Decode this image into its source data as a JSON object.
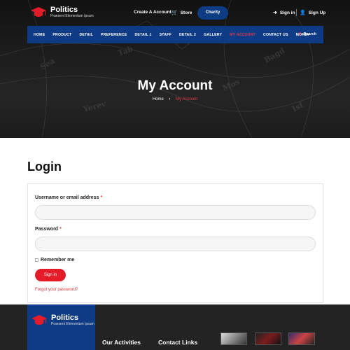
{
  "brand": {
    "name": "Politics",
    "tagline": "Praesent Elementum Ipsum"
  },
  "topbar": {
    "create_account": "Create A Account",
    "store": "Store",
    "charity": "Charity",
    "sign_in": "Sign in",
    "sign_up": "Sign Up"
  },
  "nav": {
    "items": [
      "HOME",
      "PRODUCT",
      "DETAIL",
      "PREFERENCE",
      "DETAIL 1",
      "STAFF",
      "DETAIL 2",
      "GALLERY",
      "MY ACCOUNT",
      "CONTACT US",
      "MORE"
    ],
    "search": "Search"
  },
  "hero": {
    "title": "My Account",
    "breadcrumb_home": "Home",
    "breadcrumb_current": "My Account"
  },
  "login": {
    "heading": "Login",
    "username_label": "Username or email address",
    "password_label": "Password",
    "required_mark": "*",
    "remember": "Remember me",
    "submit": "Sign in",
    "forgot": "Forgot your password?"
  },
  "footer": {
    "activities": "Our Activities",
    "contact": "Contact Links"
  },
  "colors": {
    "navy": "#0e3b86",
    "accent_red": "#e51b2a",
    "footer_bg": "#232323"
  }
}
